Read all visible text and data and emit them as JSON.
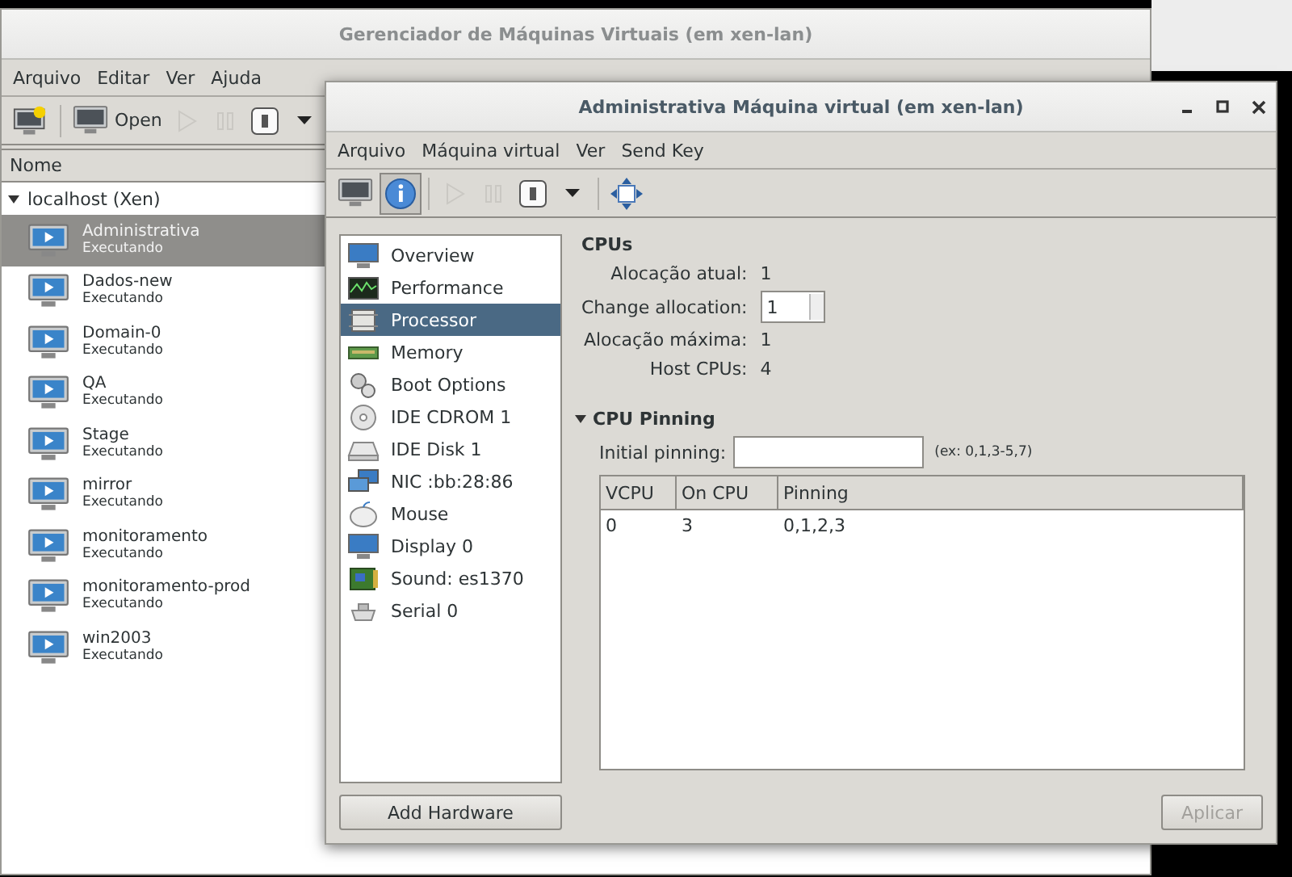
{
  "main_window": {
    "title": "Gerenciador de Máquinas Virtuais (em xen-lan)",
    "menu": [
      "Arquivo",
      "Editar",
      "Ver",
      "Ajuda"
    ],
    "toolbar": [
      [
        {
          "kind": "new",
          "disabled": false
        }
      ],
      [
        {
          "kind": "open",
          "label": "Open",
          "disabled": false
        },
        {
          "kind": "play",
          "disabled": true
        },
        {
          "kind": "pause",
          "disabled": true
        },
        {
          "kind": "shutdown",
          "disabled": false
        },
        {
          "kind": "dropdown",
          "disabled": false
        }
      ]
    ],
    "list_header": "Nome",
    "host": {
      "label": "localhost (Xen)",
      "expanded": true,
      "children": [
        {
          "name": "Administrativa",
          "status": "Executando",
          "selected": true
        },
        {
          "name": "Dados-new",
          "status": "Executando",
          "selected": false
        },
        {
          "name": "Domain-0",
          "status": "Executando",
          "selected": false
        },
        {
          "name": "QA",
          "status": "Executando",
          "selected": false
        },
        {
          "name": "Stage",
          "status": "Executando",
          "selected": false
        },
        {
          "name": "mirror",
          "status": "Executando",
          "selected": false
        },
        {
          "name": "monitoramento",
          "status": "Executando",
          "selected": false
        },
        {
          "name": "monitoramento-prod",
          "status": "Executando",
          "selected": false
        },
        {
          "name": "win2003",
          "status": "Executando",
          "selected": false
        }
      ]
    }
  },
  "vm_window": {
    "title": "Administrativa Máquina virtual (em xen-lan)",
    "menu": [
      "Arquivo",
      "Máquina virtual",
      "Ver",
      "Send Key"
    ],
    "toolbar": [
      [
        {
          "kind": "console",
          "pressed": false,
          "disabled": false
        },
        {
          "kind": "details",
          "pressed": true,
          "disabled": false
        }
      ],
      [
        {
          "kind": "play",
          "pressed": false,
          "disabled": true
        },
        {
          "kind": "pause",
          "pressed": false,
          "disabled": true
        },
        {
          "kind": "shutdown",
          "pressed": false,
          "disabled": false
        },
        {
          "kind": "dropdown",
          "pressed": false,
          "disabled": false
        }
      ],
      [
        {
          "kind": "fullscreen",
          "pressed": false,
          "disabled": false
        }
      ]
    ],
    "hardware": [
      {
        "kind": "overview",
        "label": "Overview",
        "selected": false
      },
      {
        "kind": "performance",
        "label": "Performance",
        "selected": false
      },
      {
        "kind": "processor",
        "label": "Processor",
        "selected": true
      },
      {
        "kind": "memory",
        "label": "Memory",
        "selected": false
      },
      {
        "kind": "boot",
        "label": "Boot Options",
        "selected": false
      },
      {
        "kind": "cdrom",
        "label": "IDE CDROM 1",
        "selected": false
      },
      {
        "kind": "disk",
        "label": "IDE Disk 1",
        "selected": false
      },
      {
        "kind": "nic",
        "label": "NIC :bb:28:86",
        "selected": false
      },
      {
        "kind": "mouse",
        "label": "Mouse",
        "selected": false
      },
      {
        "kind": "display",
        "label": "Display 0",
        "selected": false
      },
      {
        "kind": "sound",
        "label": "Sound: es1370",
        "selected": false
      },
      {
        "kind": "serial",
        "label": "Serial 0",
        "selected": false
      }
    ],
    "add_hardware_button": "Add Hardware",
    "cpus": {
      "title": "CPUs",
      "fields": [
        {
          "kind": "text",
          "label": "Alocação atual:",
          "value": "1"
        },
        {
          "kind": "spin",
          "label": "Change allocation:",
          "value": "1"
        },
        {
          "kind": "text",
          "label": "Alocação máxima:",
          "value": "1"
        },
        {
          "kind": "text",
          "label": "Host CPUs:",
          "value": "4"
        }
      ]
    },
    "pinning": {
      "title": "CPU Pinning",
      "expanded": true,
      "initial_label": "Initial pinning:",
      "hint": "(ex: 0,1,3-5,7)",
      "columns": [
        "VCPU",
        "On CPU",
        "Pinning"
      ],
      "rows": [
        [
          "0",
          "3",
          "0,1,2,3"
        ]
      ]
    },
    "apply_button": {
      "label": "Aplicar",
      "disabled": true
    }
  }
}
